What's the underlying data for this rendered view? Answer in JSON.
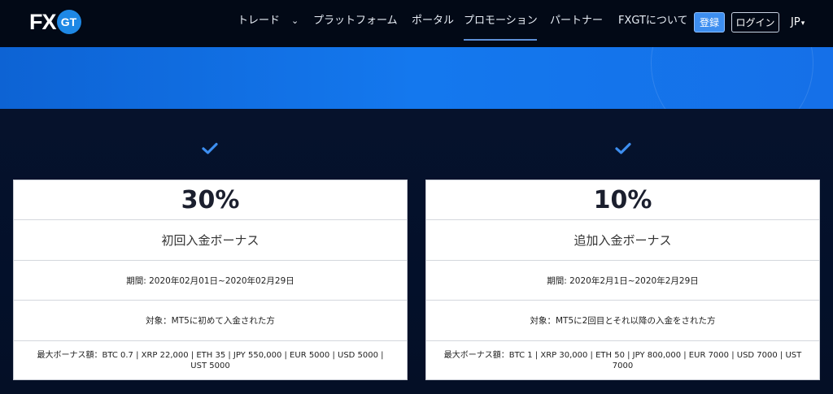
{
  "nav": {
    "logo_fx": "FX",
    "logo_gt": "GT",
    "items": [
      {
        "label": "トレード"
      },
      {
        "label": "プラットフォーム"
      },
      {
        "label": "ポータル"
      },
      {
        "label": "プロモーション"
      },
      {
        "label": "パートナー"
      },
      {
        "label": "FXGTについて"
      }
    ],
    "trade_chevron": "⌄",
    "register_label": "登録",
    "login_label": "ログイン",
    "lang_label": "JP",
    "lang_caret": "▾"
  },
  "cards": [
    {
      "percent": "30%",
      "title": "初回入金ボーナス",
      "period": "期間: 2020年02月01日~2020年02月29日",
      "target": "対象：MT5に初めて入金された方",
      "max_bonus": "最大ボーナス額：BTC 0.7 | XRP 22,000 | ETH 35 | JPY 550,000 | EUR 5000 | USD 5000 | UST 5000"
    },
    {
      "percent": "10%",
      "title": "追加入金ボーナス",
      "period": "期間: 2020年2月1日~2020年2月29日",
      "target": "対象：MT5に2回目とそれ以降の入金をされた方",
      "max_bonus": "最大ボーナス額：BTC 1 | XRP 30,000 | ETH 50 | JPY 800,000 | EUR 7000 | USD 7000 | UST 7000"
    }
  ],
  "colors": {
    "accent_blue": "#3d8ef0",
    "hero_blue": "#1478ee",
    "check_blue": "#3d8ef0",
    "nav_bg": "#020916"
  },
  "icons": {
    "check": "check-icon",
    "chevron": "chevron-down-icon",
    "caret": "caret-down-icon"
  }
}
